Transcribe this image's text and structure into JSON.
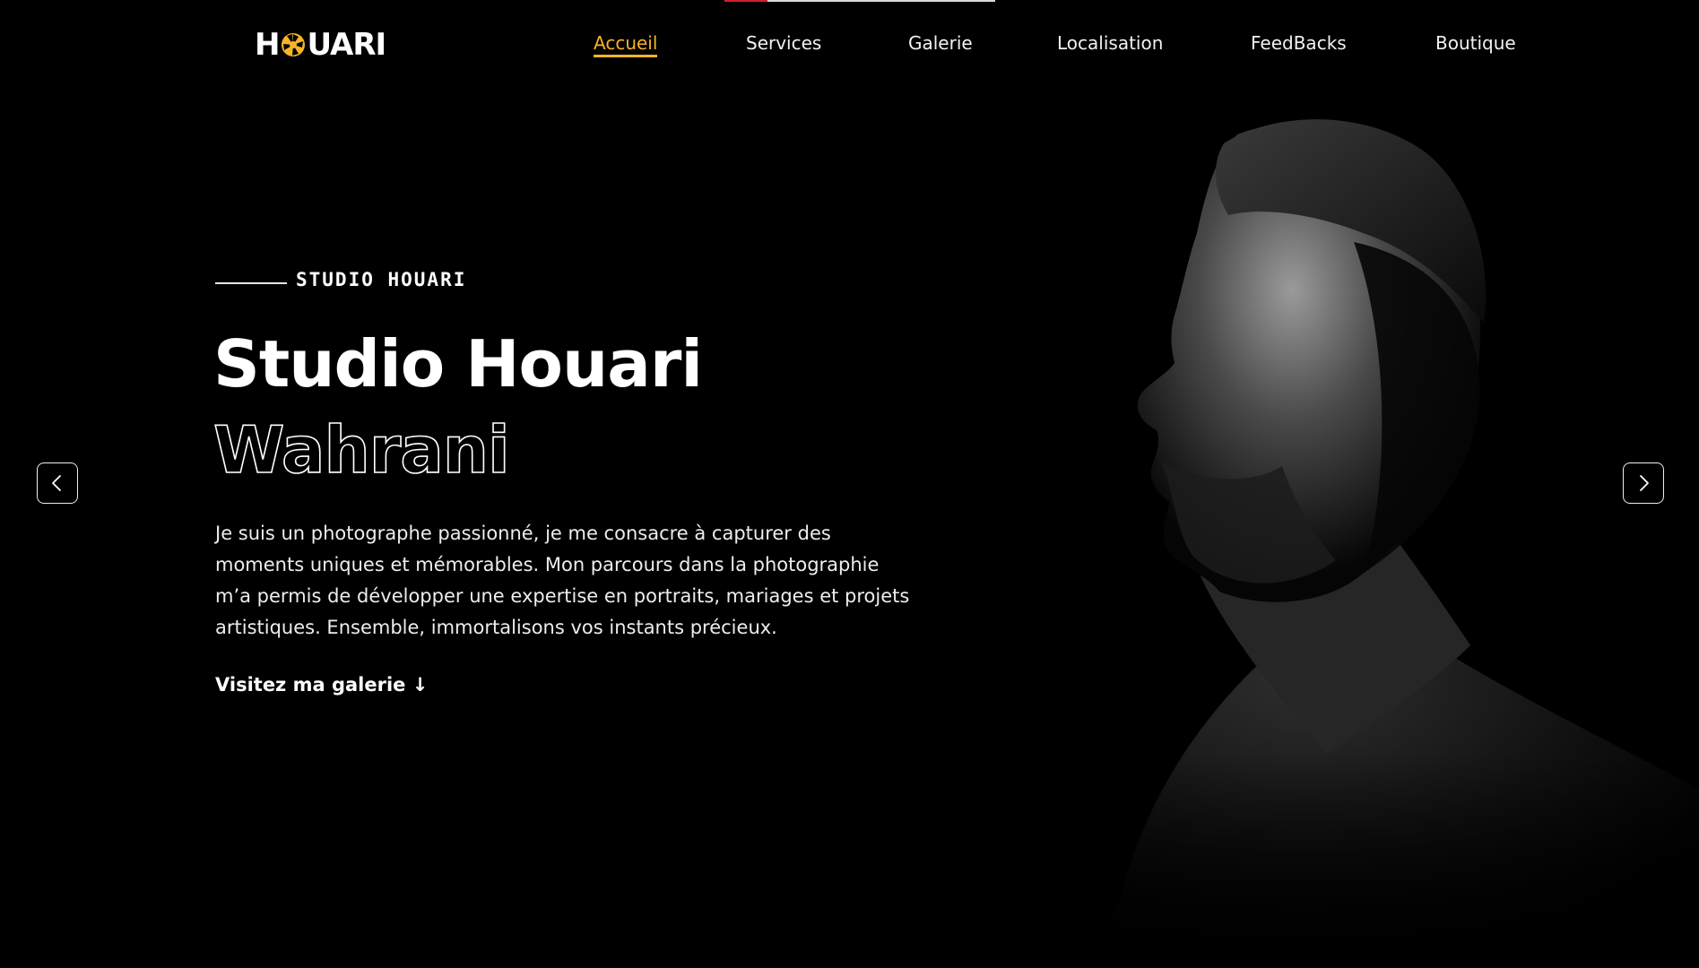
{
  "header": {
    "logo_text_left": "H",
    "logo_text_right": "UARI",
    "logo_accent_color": "#f5b427",
    "nav": [
      {
        "label": "Accueil",
        "active": true
      },
      {
        "label": "Services",
        "active": false
      },
      {
        "label": "Galerie",
        "active": false
      },
      {
        "label": "Localisation",
        "active": false
      },
      {
        "label": "FeedBacks",
        "active": false
      },
      {
        "label": "Boutique",
        "active": false
      }
    ]
  },
  "slider": {
    "progress": 0.16,
    "progress_color": "#d21f2b",
    "prev_icon": "chevron-left-icon",
    "next_icon": "chevron-right-icon"
  },
  "hero": {
    "eyebrow": "STUDIO HOUARI",
    "title": "Studio Houari",
    "subtitle": "Wahrani",
    "description": "Je suis un photographe passionné, je me consacre à capturer des moments uniques et mémorables. Mon parcours dans la photographie m’a permis de développer une expertise en portraits, mariages et projets artistiques. Ensemble, immortalisons vos instants précieux.",
    "cta": "Visitez ma galerie ↓"
  },
  "colors": {
    "background": "#000000",
    "accent": "#f5b427",
    "text": "#ffffff"
  }
}
